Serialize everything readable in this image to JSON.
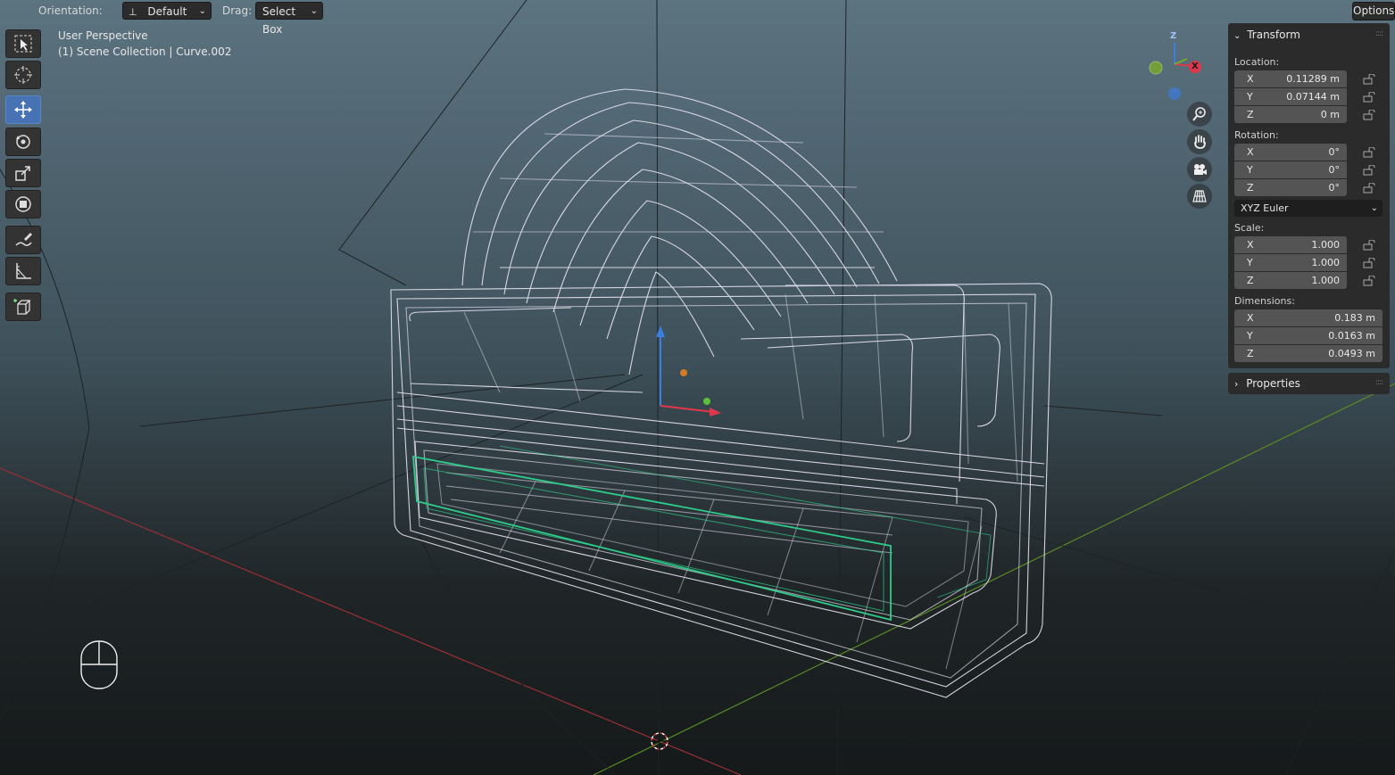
{
  "header": {
    "orientation_label": "Orientation:",
    "orientation_value": "Default",
    "drag_label": "Drag:",
    "drag_value": "Select Box",
    "options_label": "Options"
  },
  "viewport": {
    "view_name": "User Perspective",
    "collection_info": "(1) Scene Collection | Curve.002"
  },
  "toolbar": {
    "tools": [
      "select-box-tool",
      "cursor-tool",
      "move-tool",
      "rotate-tool",
      "scale-tool",
      "transform-tool",
      "annotate-tool",
      "measure-tool",
      "add-cube-tool"
    ],
    "active_tool": "move-tool"
  },
  "gizmo": {
    "z_label": "Z",
    "x_label": "X",
    "colors": {
      "x": "#e0384a",
      "y": "#7aaa2a",
      "z": "#3a7ee0"
    }
  },
  "navigation": [
    "zoom-icon",
    "pan-hand-icon",
    "camera-icon",
    "grid-perspective-icon"
  ],
  "transform_panel": {
    "title": "Transform",
    "location_label": "Location:",
    "location": [
      {
        "axis": "X",
        "value": "0.11289 m"
      },
      {
        "axis": "Y",
        "value": "0.07144 m"
      },
      {
        "axis": "Z",
        "value": "0 m"
      }
    ],
    "rotation_label": "Rotation:",
    "rotation": [
      {
        "axis": "X",
        "value": "0°"
      },
      {
        "axis": "Y",
        "value": "0°"
      },
      {
        "axis": "Z",
        "value": "0°"
      }
    ],
    "rotation_mode": "XYZ Euler",
    "scale_label": "Scale:",
    "scale": [
      {
        "axis": "X",
        "value": "1.000"
      },
      {
        "axis": "Y",
        "value": "1.000"
      },
      {
        "axis": "Z",
        "value": "1.000"
      }
    ],
    "dimensions_label": "Dimensions:",
    "dimensions": [
      {
        "axis": "X",
        "value": "0.183 m"
      },
      {
        "axis": "Y",
        "value": "0.0163 m"
      },
      {
        "axis": "Z",
        "value": "0.0493 m"
      }
    ]
  },
  "properties_panel": {
    "title": "Properties"
  },
  "colors": {
    "accent": "#4772b3",
    "wire": "#e4e0ee",
    "selected_wire": "#2ecb8a",
    "x_axis": "#b0303a",
    "y_axis": "#5a8a24"
  }
}
